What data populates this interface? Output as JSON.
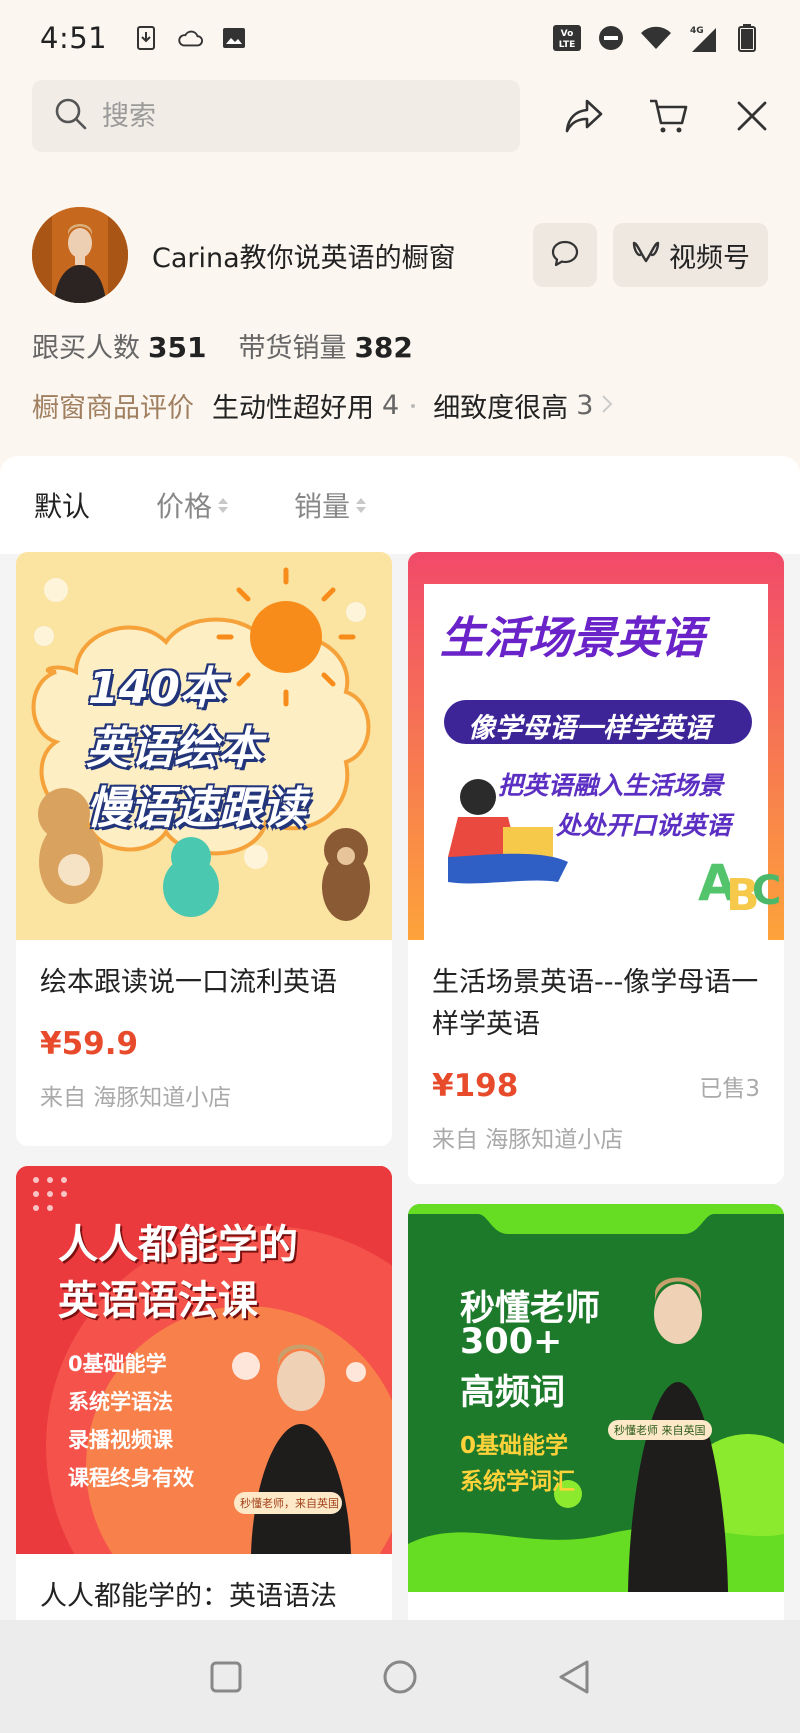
{
  "status_bar": {
    "time": "4:51",
    "network": "4G",
    "volte": "Vo LTE"
  },
  "search": {
    "placeholder": "搜索"
  },
  "profile": {
    "name": "Carina教你说英语的橱窗",
    "channel_label": "视频号"
  },
  "stats": {
    "followers_label": "跟买人数",
    "followers_value": "351",
    "sales_label": "带货销量",
    "sales_value": "382"
  },
  "reviews": {
    "title": "橱窗商品评价",
    "tags": [
      {
        "label": "生动性超好用",
        "count": "4"
      },
      {
        "label": "细致度很高",
        "count": "3"
      }
    ]
  },
  "sort": {
    "default": "默认",
    "price": "价格",
    "sales": "销量"
  },
  "products": [
    {
      "title": "绘本跟读说一口流利英语",
      "price": "¥59.9",
      "shop": "来自 海豚知道小店",
      "art": {
        "line1": "140本",
        "line2": "英语绘本",
        "line3": "慢语速跟读"
      }
    },
    {
      "title": "生活场景英语---像学母语一样学英语",
      "price": "¥198",
      "sold": "已售3",
      "shop": "来自 海豚知道小店",
      "art": {
        "headline": "生活场景英语",
        "banner": "像学母语一样学英语",
        "sub1": "把英语融入生活场景",
        "sub2": "处处开口说英语"
      }
    },
    {
      "title": "人人都能学的：英语语法",
      "art": {
        "line1": "人人都能学的",
        "line2": "英语语法课",
        "b1": "0基础能学",
        "b2": "系统学语法",
        "b3": "录播视频课",
        "b4": "课程终身有效",
        "tag": "秒懂老师，来自英国"
      }
    },
    {
      "title": "",
      "art": {
        "line1": "秒懂老师",
        "line2": "300+",
        "line3": "高频词",
        "b1": "0基础能学",
        "b2": "系统学词汇",
        "tag": "秒懂老师  来自英国"
      }
    }
  ]
}
